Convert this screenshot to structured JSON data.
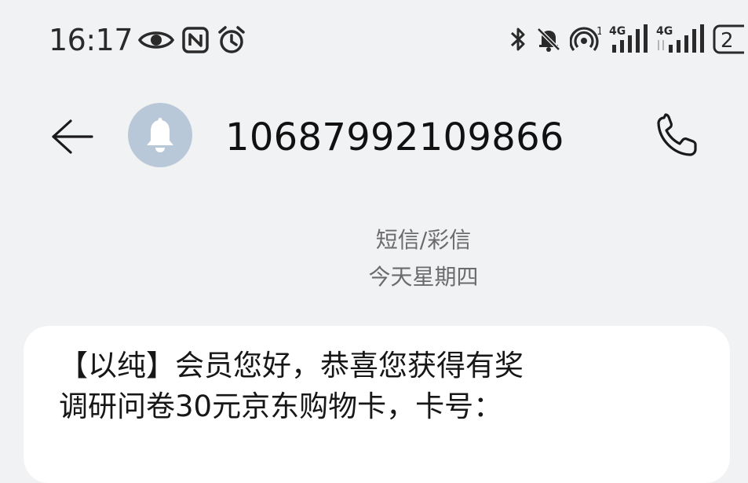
{
  "status_bar": {
    "time": "16:17",
    "left_icons": [
      "eye-icon",
      "nfc-icon",
      "alarm-icon"
    ],
    "right_icons": [
      "bluetooth-icon",
      "mute-bell-icon",
      "hotspot-icon",
      "signal-4g-icon",
      "signal-4g-icon",
      "battery-icon"
    ],
    "hotspot_count": "1",
    "network_type_1": "4G",
    "network_type_2": "4G",
    "battery_text": "2"
  },
  "header": {
    "contact_number": "10687992109866",
    "avatar_icon": "bell-icon",
    "avatar_color": "#b9c8d8"
  },
  "thread": {
    "message_type": "短信/彩信",
    "date_label": "今天星期四"
  },
  "messages": [
    {
      "text": "【以纯】会员您好，恭喜您获得有奖\n调研问卷30元京东购物卡，卡号："
    }
  ]
}
